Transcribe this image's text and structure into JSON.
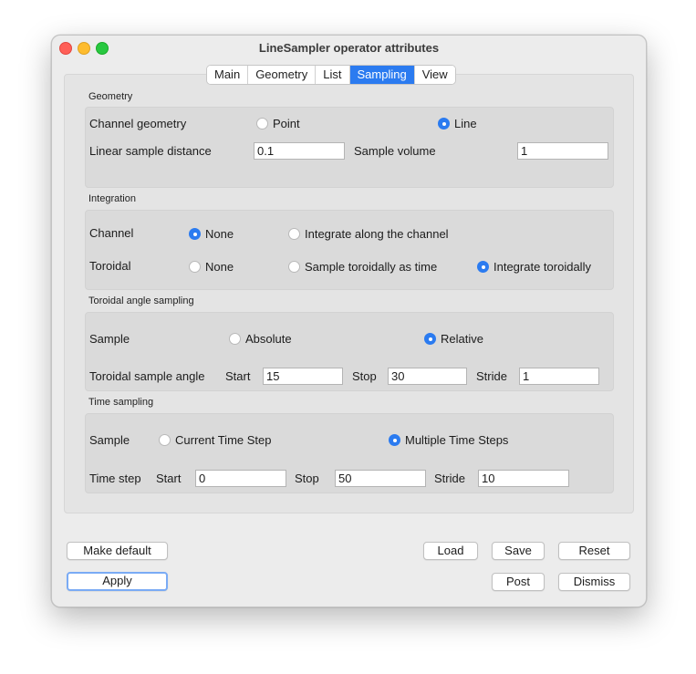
{
  "window": {
    "title": "LineSampler operator attributes"
  },
  "tabs": [
    "Main",
    "Geometry",
    "List",
    "Sampling",
    "View"
  ],
  "active_tab": "Sampling",
  "geometry": {
    "section": "Geometry",
    "channel_geometry_label": "Channel geometry",
    "point_label": "Point",
    "line_label": "Line",
    "selected": "Line",
    "linear_sample_distance_label": "Linear sample distance",
    "linear_sample_distance_value": "0.1",
    "sample_volume_label": "Sample volume",
    "sample_volume_value": "1"
  },
  "integration": {
    "section": "Integration",
    "channel_label": "Channel",
    "channel_none": "None",
    "channel_integrate": "Integrate along the channel",
    "channel_selected": "None",
    "toroidal_label": "Toroidal",
    "toroidal_none": "None",
    "toroidal_sample_time": "Sample toroidally as time",
    "toroidal_integrate": "Integrate toroidally",
    "toroidal_selected": "Integrate toroidally"
  },
  "toroidal_angle": {
    "section": "Toroidal angle sampling",
    "sample_label": "Sample",
    "absolute": "Absolute",
    "relative": "Relative",
    "selected": "Relative",
    "angle_label": "Toroidal sample angle",
    "start_label": "Start",
    "start_value": "15",
    "stop_label": "Stop",
    "stop_value": "30",
    "stride_label": "Stride",
    "stride_value": "1"
  },
  "time_sampling": {
    "section": "Time sampling",
    "sample_label": "Sample",
    "current": "Current Time Step",
    "multiple": "Multiple Time Steps",
    "selected": "Multiple Time Steps",
    "time_step_label": "Time step",
    "start_label": "Start",
    "start_value": "0",
    "stop_label": "Stop",
    "stop_value": "50",
    "stride_label": "Stride",
    "stride_value": "10"
  },
  "buttons": {
    "make_default": "Make default",
    "load": "Load",
    "save": "Save",
    "reset": "Reset",
    "apply": "Apply",
    "post": "Post",
    "dismiss": "Dismiss"
  },
  "colors": {
    "accent": "#2b7bf0",
    "close": "#ff5f57",
    "minimize": "#febc2e",
    "maximize": "#28c840"
  }
}
